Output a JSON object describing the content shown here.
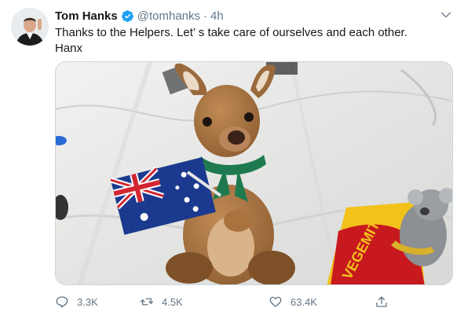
{
  "user": {
    "name": "Tom Hanks",
    "handle": "@tomhanks",
    "separator": "·",
    "time": "4h"
  },
  "tweet": {
    "line1": "Thanks to the Helpers. Let’   s take care of ourselves and each other.",
    "line2": "Hanx"
  },
  "media": {
    "flag_alt": "Australian flag",
    "jar_label": "VEGEMITE"
  },
  "actions": {
    "reply_count": "3.3K",
    "retweet_count": "4.5K",
    "like_count": "63.4K"
  },
  "colors": {
    "verified": "#1da1f2",
    "meta": "#657786",
    "text": "#14171a"
  }
}
